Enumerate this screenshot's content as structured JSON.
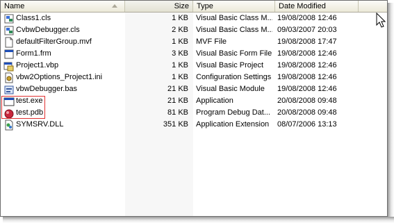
{
  "columns": {
    "name": "Name",
    "size": "Size",
    "type": "Type",
    "date": "Date Modified"
  },
  "sort_icon": "sort-up-arrow-icon",
  "files": [
    {
      "name": "Class1.cls",
      "size": "1 KB",
      "type": "Visual Basic Class M...",
      "date": "19/08/2008 12:46",
      "icon": "vb-class-icon"
    },
    {
      "name": "CvbwDebugger.cls",
      "size": "2 KB",
      "type": "Visual Basic Class M...",
      "date": "09/03/2007 20:03",
      "icon": "vb-class-icon"
    },
    {
      "name": "defaultFilterGroup.mvf",
      "size": "1 KB",
      "type": "MVF File",
      "date": "19/08/2008 17:47",
      "icon": "generic-file-icon"
    },
    {
      "name": "Form1.frm",
      "size": "3 KB",
      "type": "Visual Basic Form File",
      "date": "19/08/2008 12:46",
      "icon": "vb-form-icon"
    },
    {
      "name": "Project1.vbp",
      "size": "1 KB",
      "type": "Visual Basic Project",
      "date": "19/08/2008 12:46",
      "icon": "vb-project-icon"
    },
    {
      "name": "vbw2Options_Project1.ini",
      "size": "1 KB",
      "type": "Configuration Settings",
      "date": "19/08/2008 12:46",
      "icon": "ini-settings-icon"
    },
    {
      "name": "vbwDebugger.bas",
      "size": "21 KB",
      "type": "Visual Basic Module",
      "date": "19/08/2008 12:46",
      "icon": "vb-module-icon"
    },
    {
      "name": "test.exe",
      "size": "21 KB",
      "type": "Application",
      "date": "20/08/2008 09:48",
      "icon": "application-icon"
    },
    {
      "name": "test.pdb",
      "size": "81 KB",
      "type": "Program Debug Dat...",
      "date": "20/08/2008 09:48",
      "icon": "pdb-file-icon"
    },
    {
      "name": "SYMSRV.DLL",
      "size": "351 KB",
      "type": "Application Extension",
      "date": "08/07/2006 13:13",
      "icon": "dll-icon"
    }
  ],
  "colors": {
    "highlight_border": "#e03030",
    "header_bg": "#ece9d8"
  }
}
